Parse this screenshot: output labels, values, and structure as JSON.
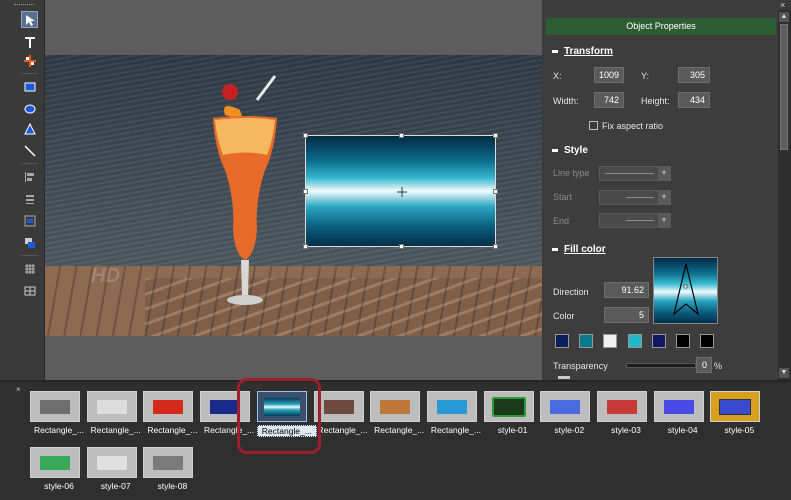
{
  "window": {
    "close_glyph": "×"
  },
  "toolbar": {
    "tools": [
      {
        "name": "select",
        "icon": "arrow-cursor-icon"
      },
      {
        "name": "text",
        "icon": "text-T-icon"
      },
      {
        "name": "move",
        "icon": "move-cross-icon"
      },
      {
        "name": "rectangle",
        "icon": "rectangle-icon"
      },
      {
        "name": "ellipse",
        "icon": "ellipse-icon"
      },
      {
        "name": "triangle",
        "icon": "triangle-icon"
      },
      {
        "name": "line",
        "icon": "line-icon"
      },
      {
        "name": "align",
        "icon": "align-icon"
      },
      {
        "name": "distribute",
        "icon": "distribute-icon"
      },
      {
        "name": "center",
        "icon": "center-icon"
      },
      {
        "name": "arrange",
        "icon": "arrange-icon"
      },
      {
        "name": "grid",
        "icon": "grid-icon"
      },
      {
        "name": "safe-area",
        "icon": "safe-area-icon"
      }
    ]
  },
  "preview": {
    "watermark": "HD"
  },
  "properties": {
    "header": "Object Properties",
    "transform": {
      "title": "Transform",
      "x_label": "X:",
      "x": "1009",
      "y_label": "Y:",
      "y": "305",
      "width_label": "Width:",
      "width": "742",
      "height_label": "Height:",
      "height": "434",
      "fix_aspect_label": "Fix aspect ratio",
      "fix_aspect_checked": false
    },
    "style": {
      "title": "Style",
      "line_type_label": "Line type",
      "start_label": "Start",
      "end_label": "End"
    },
    "fill": {
      "title": "Fill color",
      "direction_label": "Direction",
      "direction": "91.62",
      "color_label": "Color",
      "color": "5",
      "swatches": [
        "#0a1f5c",
        "#0a7a8a",
        "#f0f0f0",
        "#20b8c8",
        "#101860",
        "#000000",
        "#000000"
      ],
      "transparency_label": "Transparency",
      "transparency": "0",
      "transparency_unit": "%"
    }
  },
  "styles_bar": {
    "close_glyph": "×",
    "items": [
      {
        "label": "Rectangle_...",
        "fill": "#6e6e6e",
        "bg": "#bdbdbd"
      },
      {
        "label": "Rectangle_...",
        "fill": "#dcdcdc",
        "bg": "#bdbdbd"
      },
      {
        "label": "Rectangle_...",
        "fill": "#d42a1c",
        "bg": "#bdbdbd"
      },
      {
        "label": "Rectangle_...",
        "fill": "#1a2a8a",
        "bg": "#bdbdbd"
      },
      {
        "label": "Rectangle_...",
        "fill": "gradient-teal",
        "bg": "#bdbdbd",
        "selected": true
      },
      {
        "label": "Rectangle_...",
        "fill": "#6d4a3e",
        "bg": "#bdbdbd"
      },
      {
        "label": "Rectangle_...",
        "fill": "#c0783a",
        "bg": "#bdbdbd"
      },
      {
        "label": "Rectangle_...",
        "fill": "#2a9ad6",
        "bg": "#bdbdbd"
      },
      {
        "label": "style-01",
        "fill": "#1a3a1a",
        "bg": "#bdbdbd"
      },
      {
        "label": "style-02",
        "fill": "#4a6ae0",
        "bg": "#bdbdbd"
      },
      {
        "label": "style-03",
        "fill": "#c83a3a",
        "bg": "#bdbdbd"
      },
      {
        "label": "style-04",
        "fill": "#4a4ae6",
        "bg": "#bdbdbd"
      },
      {
        "label": "style-05",
        "fill": "#3a4ad0",
        "bg": "#d8a020"
      },
      {
        "label": "style-06",
        "fill": "#3aaa5a",
        "bg": "#bdbdbd"
      },
      {
        "label": "style-07",
        "fill": "#e0e0e0",
        "bg": "#bdbdbd"
      },
      {
        "label": "style-08",
        "fill": "#7a7a7a",
        "bg": "#bdbdbd"
      }
    ]
  }
}
